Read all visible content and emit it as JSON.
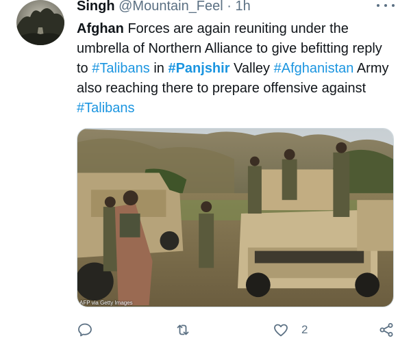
{
  "header": {
    "name": "Singh",
    "handle": "@Mountain_Feel",
    "separator": "·",
    "time": "1h"
  },
  "tweet": {
    "segments": [
      "Afghan",
      " Forces are again reuniting under the umbrella of Northern Alliance to give befitting reply to ",
      "#Talibans",
      " in ",
      "#Panjshir",
      " Valley ",
      "#Afghanistan",
      " Army also reaching there to prepare offensive against ",
      "#Talibans"
    ]
  },
  "media": {
    "credit": "AFP via Getty Images"
  },
  "actions": {
    "reply_icon": "reply-icon",
    "retweet_icon": "retweet-icon",
    "like_icon": "heart-icon",
    "like_count": "2",
    "share_icon": "share-icon"
  },
  "colors": {
    "hashtag": "#1b95e0",
    "muted": "#5b7083",
    "text": "#0f1419"
  }
}
